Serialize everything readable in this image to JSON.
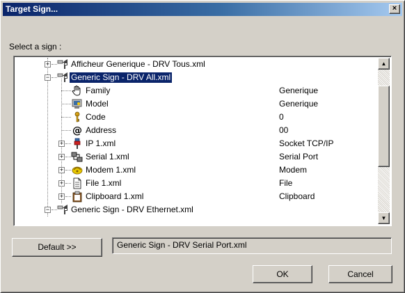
{
  "window": {
    "title": "Target Sign...",
    "close_glyph": "×"
  },
  "prompt": "Select a sign :",
  "tree": {
    "expand_glyph": "+",
    "collapse_glyph": "−",
    "rows": [
      {
        "label": "Afficheur Generique - DRV Tous.xml",
        "value": "",
        "icon": "sign-icon"
      },
      {
        "label": "Generic Sign - DRV All.xml",
        "value": "",
        "icon": "sign-icon",
        "selected": true
      },
      {
        "label": "Family",
        "value": "Generique",
        "icon": "hand-icon"
      },
      {
        "label": "Model",
        "value": "Generique",
        "icon": "monitor-icon"
      },
      {
        "label": "Code",
        "value": "0",
        "icon": "key-icon"
      },
      {
        "label": "Address",
        "value": "00",
        "icon": "at-icon"
      },
      {
        "label": "IP 1.xml",
        "value": "Socket TCP/IP",
        "icon": "network-plug-icon"
      },
      {
        "label": "Serial 1.xml",
        "value": "Serial Port",
        "icon": "serial-port-icon"
      },
      {
        "label": "Modem 1.xml",
        "value": "Modem",
        "icon": "modem-icon"
      },
      {
        "label": "File 1.xml",
        "value": "File",
        "icon": "file-icon"
      },
      {
        "label": "Clipboard 1.xml",
        "value": "Clipboard",
        "icon": "clipboard-icon"
      },
      {
        "label": "Generic Sign - DRV Ethernet.xml",
        "value": "",
        "icon": "sign-icon"
      }
    ]
  },
  "scroll": {
    "up_glyph": "▲",
    "down_glyph": "▼"
  },
  "default_button": "Default >>",
  "selected_path": "Generic Sign - DRV Serial Port.xml",
  "ok_button": "OK",
  "cancel_button": "Cancel",
  "colors": {
    "title_start": "#0a246a",
    "title_end": "#a6caf0",
    "selection": "#0a246a",
    "face": "#d4d0c8"
  }
}
